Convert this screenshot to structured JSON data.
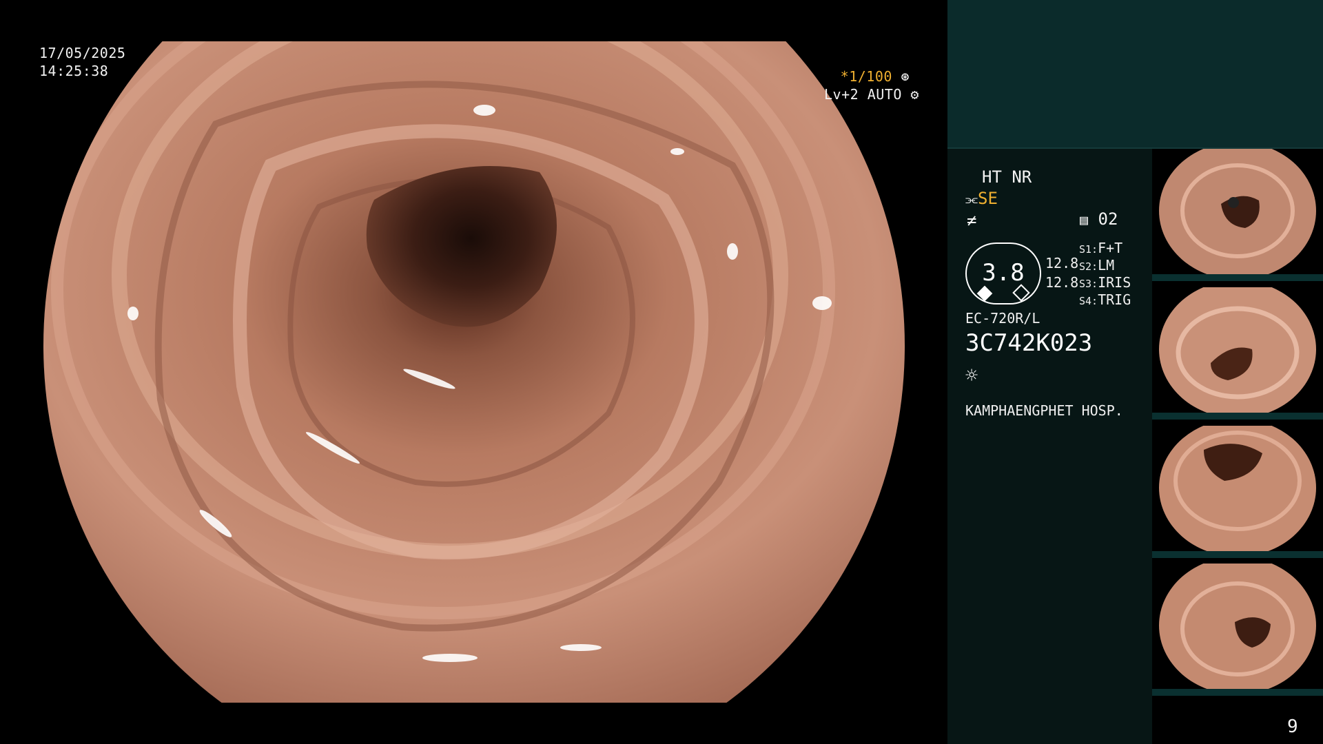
{
  "overlay": {
    "date": "17/05/2025",
    "time": "14:25:38",
    "shutter": "*1/100",
    "level_auto": "Lv+2 AUTO"
  },
  "panel": {
    "ht_nr": "HT NR",
    "se": "SE",
    "channel": "02",
    "level_value": "3.8",
    "val_1": "12.8",
    "val_2": "12.8",
    "switches": [
      {
        "key": "S1:",
        "value": "F+T"
      },
      {
        "key": "S2:",
        "value": "LM"
      },
      {
        "key": "S3:",
        "value": "IRIS"
      },
      {
        "key": "S4:",
        "value": "TRIG"
      }
    ],
    "scope_model": "EC-720R/L",
    "scope_serial": "3C742K023",
    "hospital": "KAMPHAENGPHET HOSP.",
    "page_number": "9"
  },
  "colors": {
    "panel_top": "#0b2b2b",
    "panel_main": "#071615",
    "accent_yellow": "#f0b030",
    "mucosa": "#c58a70"
  },
  "icons": [
    "aperture-icon",
    "gear-icon",
    "pump-icon",
    "flash-icon",
    "memo-icon",
    "light-icon"
  ]
}
